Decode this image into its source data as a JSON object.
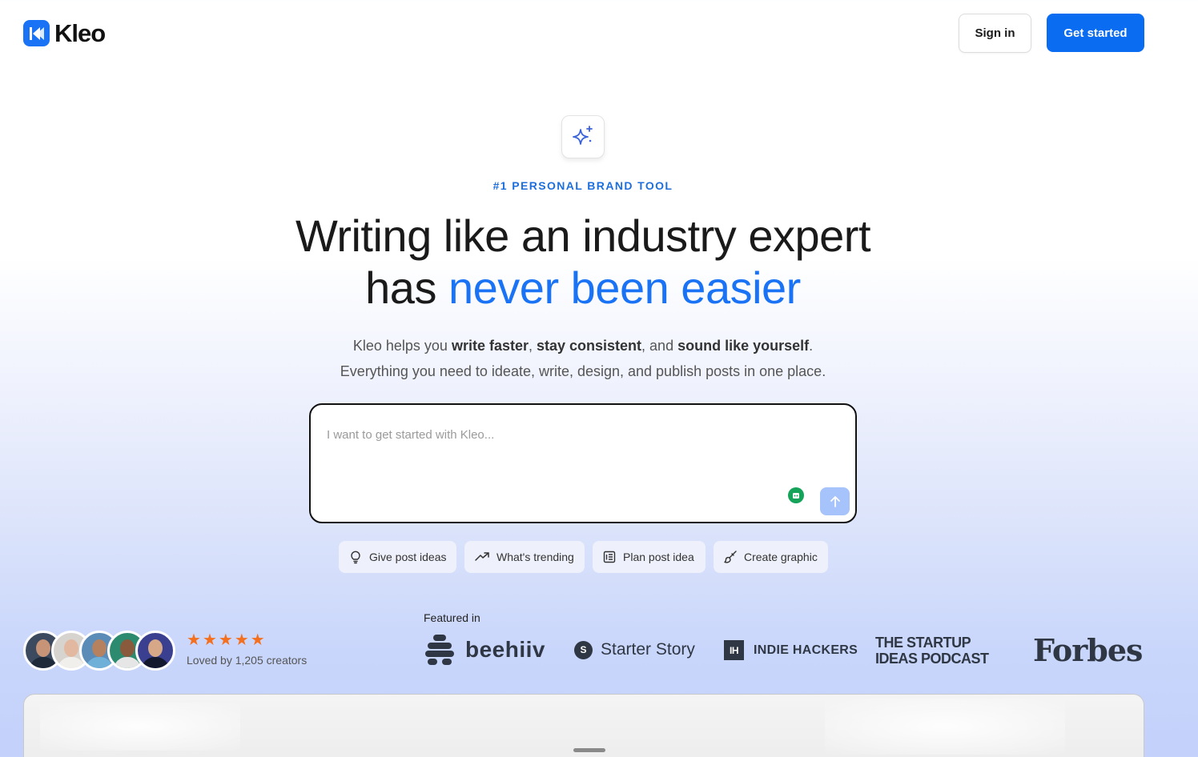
{
  "header": {
    "brand": "Kleo",
    "signin_label": "Sign in",
    "getstarted_label": "Get started"
  },
  "hero": {
    "eyebrow": "#1 PERSONAL BRAND TOOL",
    "headline_line1": "Writing like an industry expert",
    "headline_line2_prefix": "has ",
    "headline_line2_accent": "never been easier",
    "sub_line1": {
      "t1": "Kleo helps you ",
      "b1": "write faster",
      "t2": ", ",
      "b2": "stay consistent",
      "t3": ", and ",
      "b3": "sound like yourself",
      "t4": "."
    },
    "sub_line2": "Everything you need to ideate, write, design, and publish posts in one place."
  },
  "prompt": {
    "value": "",
    "placeholder": "I want to get started with Kleo..."
  },
  "chips": [
    {
      "label": "Give post ideas",
      "icon": "lightbulb-icon"
    },
    {
      "label": "What's trending",
      "icon": "trending-up-icon"
    },
    {
      "label": "Plan post idea",
      "icon": "document-icon"
    },
    {
      "label": "Create graphic",
      "icon": "brush-icon"
    }
  ],
  "social_proof": {
    "rating_stars": 5,
    "loved_text": "Loved by 1,205 creators",
    "avatar_count": 5
  },
  "featured": {
    "label": "Featured in",
    "beehiiv": "beehiiv",
    "starter_story": "Starter Story",
    "starter_badge": "S",
    "indie_hackers": "INDIE HACKERS",
    "indie_badge": "IH",
    "startup_line1": "THE STARTUP",
    "startup_line2": "IDEAS PODCAST",
    "forbes": "Forbes"
  },
  "colors": {
    "accent": "#1a73f5",
    "primary_button": "#0a6cf0",
    "star": "#f4701e",
    "send_button": "#a6c3fb"
  }
}
